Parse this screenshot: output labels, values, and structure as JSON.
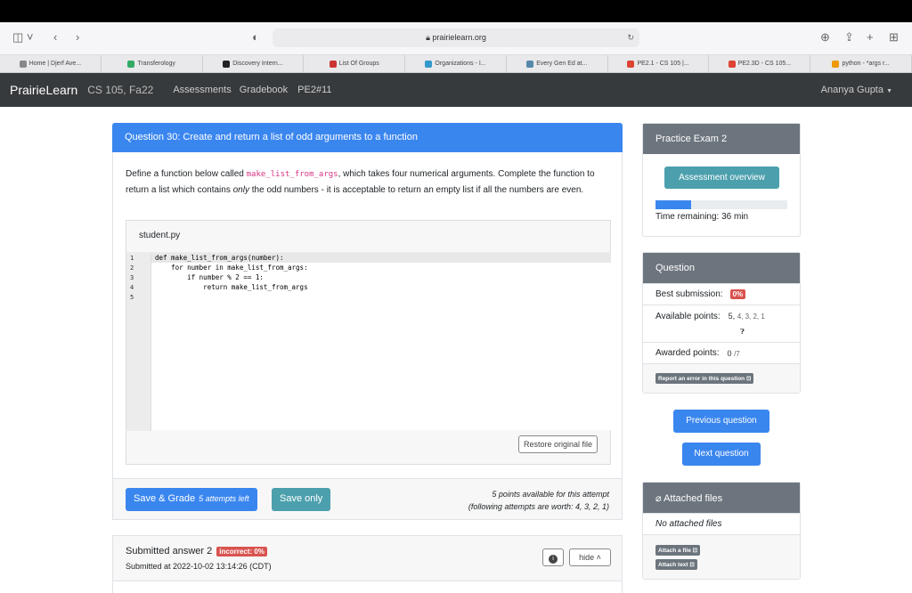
{
  "browser": {
    "url": "prairielearn.org",
    "tabs": [
      {
        "label": "Home | Djerf Ave...",
        "color": "#888"
      },
      {
        "label": "Transferology",
        "color": "#3a6"
      },
      {
        "label": "Discovery Intern...",
        "color": "#222"
      },
      {
        "label": "List Of Groups",
        "color": "#c33"
      },
      {
        "label": "Organizations - I...",
        "color": "#39c"
      },
      {
        "label": "Every Gen Ed at...",
        "color": "#58a"
      },
      {
        "label": "PE2.1 - CS 105 |...",
        "color": "#d43"
      },
      {
        "label": "PE2.3D - CS 105...",
        "color": "#d43"
      },
      {
        "label": "python - *args r...",
        "color": "#e90"
      }
    ]
  },
  "nav": {
    "brand": "PrairieLearn",
    "course": "CS 105, Fa22",
    "links": [
      "Assessments",
      "Gradebook",
      "PE2#11"
    ],
    "user": "Ananya Gupta"
  },
  "question": {
    "title": "Question 30: Create and return a list of odd arguments to a function",
    "text_a": "Define a function below called ",
    "func_name": "make_list_from_args",
    "text_b": ", which takes four numerical arguments. Complete the function to return a list which contains ",
    "text_only": "only",
    "text_c": " the odd numbers - it is acceptable to return an empty list if all the numbers are even.",
    "file_name": "student.py",
    "line_numbers": [
      "1",
      "2",
      "3",
      "4",
      "5"
    ],
    "code_lines": [
      "def make_list_from_args(number):",
      "    for number in make_list_from_args:",
      "        if number % 2 == 1:",
      "            return make_list_from_args",
      ""
    ],
    "restore_label": "Restore original file",
    "save_grade_label": "Save & Grade",
    "attempts_left": "5 attempts left",
    "save_only_label": "Save only",
    "points_line1": "5 points available for this attempt",
    "points_line2": "(following attempts are worth: 4, 3, 2, 1)"
  },
  "submission": {
    "title": "Submitted answer 2",
    "badge": "incorrect: 0%",
    "date": "Submitted at 2022-10-02 13:14:26 (CDT)",
    "hide_label": "hide"
  },
  "sidebar": {
    "exam_title": "Practice Exam 2",
    "overview_label": "Assessment overview",
    "progress_fraction": 0.27,
    "time_remaining": "Time remaining: 36 min",
    "q_title": "Question",
    "best_label": "Best submission:",
    "best_value": "0%",
    "available_label": "Available points:",
    "available_first": "5,",
    "available_rest": "4, 3, 2, 1",
    "awarded_label": "Awarded points:",
    "awarded_value": "0",
    "awarded_total": "/7",
    "report_label": "Report an error in this question",
    "prev_label": "Previous question",
    "next_label": "Next question",
    "files_title": "Attached files",
    "no_files": "No attached files",
    "attach_file": "Attach a file",
    "attach_text": "Attach text"
  }
}
